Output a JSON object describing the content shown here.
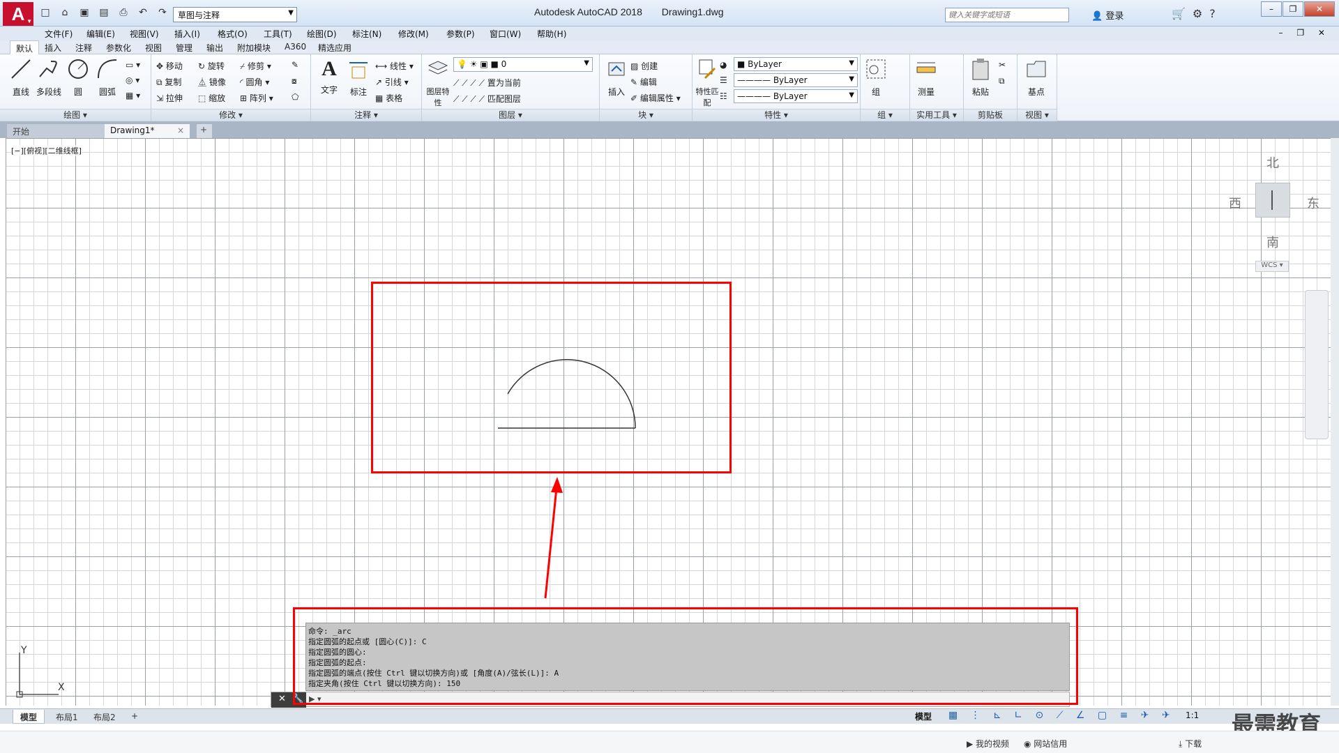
{
  "titlebar": {
    "app_name": "Autodesk AutoCAD 2018",
    "document": "Drawing1.dwg",
    "workspace": "草图与注释",
    "search_placeholder": "键入关键字或短语",
    "signin_label": "登录"
  },
  "menubar": {
    "items": [
      "文件(F)",
      "编辑(E)",
      "视图(V)",
      "插入(I)",
      "格式(O)",
      "工具(T)",
      "绘图(D)",
      "标注(N)",
      "修改(M)",
      "参数(P)",
      "窗口(W)",
      "帮助(H)"
    ]
  },
  "ribbon_tabs": [
    "默认",
    "插入",
    "注释",
    "参数化",
    "视图",
    "管理",
    "输出",
    "附加模块",
    "A360",
    "精选应用"
  ],
  "ribbon": {
    "draw": {
      "title": "绘图",
      "line": "直线",
      "polyline": "多段线",
      "circle": "圆",
      "arc": "圆弧"
    },
    "modify": {
      "title": "修改",
      "move": "移动",
      "rotate": "旋转",
      "trim": "修剪",
      "copy": "复制",
      "mirror": "镜像",
      "fillet": "圆角",
      "stretch": "拉伸",
      "scale": "缩放",
      "array": "阵列"
    },
    "annotation": {
      "title": "注释",
      "text": "文字",
      "dimension": "标注",
      "linear": "线性",
      "leader": "引线",
      "table": "表格"
    },
    "layers": {
      "title": "图层",
      "layer_props": "图层特性",
      "current_layer": "0",
      "set_current": "置为当前",
      "match_layer": "匹配图层"
    },
    "block": {
      "title": "块",
      "insert": "插入",
      "create": "创建",
      "edit": "编辑",
      "edit_attr": "编辑属性"
    },
    "properties": {
      "title": "特性",
      "match": "特性匹配",
      "color": "ByLayer",
      "linetype": "ByLayer",
      "lineweight": "ByLayer"
    },
    "groups": {
      "title": "组",
      "group": "组"
    },
    "utilities": {
      "title": "实用工具",
      "measure": "测量"
    },
    "clipboard": {
      "title": "剪贴板",
      "paste": "粘贴"
    },
    "view": {
      "title": "视图",
      "base": "基点"
    }
  },
  "file_tabs": {
    "start": "开始",
    "active": "Drawing1*"
  },
  "viewport_label": "[−][俯视][二维线框]",
  "viewcube": {
    "north": "北",
    "south": "南",
    "east": "东",
    "west": "西",
    "wcs": "WCS"
  },
  "ucs": {
    "x": "X",
    "y": "Y"
  },
  "command": {
    "history": [
      "命令: _arc",
      "指定圆弧的起点或 [圆心(C)]: C",
      "指定圆弧的圆心:",
      "指定圆弧的起点:",
      "指定圆弧的端点(按住 Ctrl 键以切换方向)或 [角度(A)/弦长(L)]: A",
      "指定夹角(按住 Ctrl 键以切换方向): 150"
    ],
    "prompt": "▶ ▾",
    "input_value": ""
  },
  "layout_tabs": [
    "模型",
    "布局1",
    "布局2"
  ],
  "status": {
    "model": "模型",
    "scale": "1:1"
  },
  "os_strip": {
    "video": "我的视频",
    "credit": "网站信用",
    "download": "下载"
  },
  "watermark": "最需教育",
  "colors": {
    "annotation": "#ff0000",
    "accent": "#c8102e",
    "grid_major": "#9aa0a8",
    "grid_minor": "#d4d7db"
  }
}
